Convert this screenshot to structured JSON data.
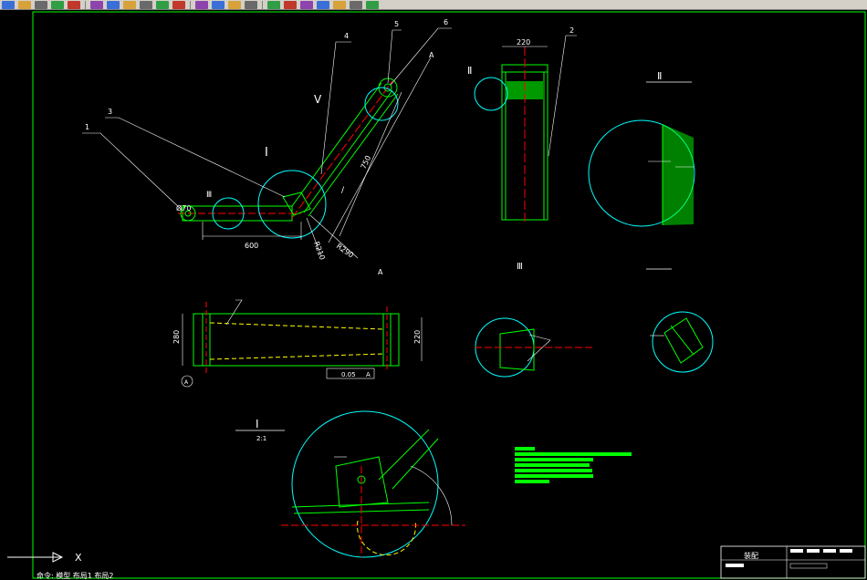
{
  "app": {
    "name": "CAD drawing viewer"
  },
  "toolbar": {
    "buttons": [
      "new-file",
      "open-file",
      "save-file",
      "print",
      "preview",
      "cut",
      "copy",
      "paste",
      "match-properties",
      "undo",
      "redo",
      "pan",
      "zoom-realtime",
      "zoom-window",
      "zoom-previous",
      "properties",
      "design-center",
      "tool-palettes",
      "layer",
      "color",
      "linetype",
      "help"
    ]
  },
  "drawing": {
    "part_labels": [
      "1",
      "2",
      "3",
      "4",
      "5",
      "6"
    ],
    "section_marks": {
      "I": "Ⅰ",
      "II": "Ⅱ",
      "III": "Ⅲ",
      "V": "Ⅴ",
      "A": "A"
    },
    "dimensions": {
      "d70": "Ø70",
      "len600": "600",
      "len750": "750",
      "r290": "R290",
      "r210": "R210",
      "w220_top": "220",
      "h280": "280",
      "h220": "220",
      "tol": "0.05",
      "datum": "A"
    },
    "detail_scale": "2:1",
    "title_block": {
      "name": "装配"
    }
  },
  "colors": {
    "outline": "#00ff00",
    "hidden": "#ffff00",
    "center": "#ff0000",
    "circles": "#00ffff",
    "dims": "#ffffff",
    "hatch": "#00ff00",
    "border": "#00ff00"
  },
  "command_line": "命令:  模型  布局1  布局2"
}
